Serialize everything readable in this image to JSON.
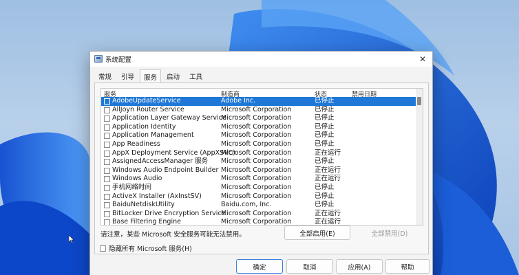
{
  "window": {
    "title": "系统配置",
    "close_glyph": "✕"
  },
  "tabs": [
    {
      "label": "常规",
      "active": false
    },
    {
      "label": "引导",
      "active": false
    },
    {
      "label": "服务",
      "active": true
    },
    {
      "label": "启动",
      "active": false
    },
    {
      "label": "工具",
      "active": false
    }
  ],
  "services": {
    "columns": {
      "service": "服务",
      "manufacturer": "制造商",
      "status": "状态",
      "disabled_date": "禁用日期"
    },
    "rows": [
      {
        "name": "AdobeUpdateService",
        "manufacturer": "Adobe Inc.",
        "status": "已停止",
        "selected": true
      },
      {
        "name": "AllJoyn Router Service",
        "manufacturer": "Microsoft Corporation",
        "status": "已停止"
      },
      {
        "name": "Application Layer Gateway Service",
        "manufacturer": "Microsoft Corporation",
        "status": "已停止"
      },
      {
        "name": "Application Identity",
        "manufacturer": "Microsoft Corporation",
        "status": "已停止"
      },
      {
        "name": "Application Management",
        "manufacturer": "Microsoft Corporation",
        "status": "已停止"
      },
      {
        "name": "App Readiness",
        "manufacturer": "Microsoft Corporation",
        "status": "已停止"
      },
      {
        "name": "AppX Deployment Service (AppXSVC)",
        "manufacturer": "Microsoft Corporation",
        "status": "正在运行"
      },
      {
        "name": "AssignedAccessManager 服务",
        "manufacturer": "Microsoft Corporation",
        "status": "已停止"
      },
      {
        "name": "Windows Audio Endpoint Builder",
        "manufacturer": "Microsoft Corporation",
        "status": "正在运行"
      },
      {
        "name": "Windows Audio",
        "manufacturer": "Microsoft Corporation",
        "status": "正在运行"
      },
      {
        "name": "手机网络时间",
        "manufacturer": "Microsoft Corporation",
        "status": "已停止"
      },
      {
        "name": "ActiveX Installer (AxInstSV)",
        "manufacturer": "Microsoft Corporation",
        "status": "已停止"
      },
      {
        "name": "BaiduNetdiskUtility",
        "manufacturer": "Baidu.com, Inc.",
        "status": "已停止"
      },
      {
        "name": "BitLocker Drive Encryption Service",
        "manufacturer": "Microsoft Corporation",
        "status": "正在运行"
      },
      {
        "name": "Base Filtering Engine",
        "manufacturer": "Microsoft Corporation",
        "status": "正在运行"
      }
    ]
  },
  "note": "请注意，某些 Microsoft 安全服务可能无法禁用。",
  "buttons": {
    "enable_all": "全部启用(E)",
    "disable_all": "全部禁用(D)",
    "ok": "确定",
    "cancel": "取消",
    "apply": "应用(A)",
    "help": "帮助"
  },
  "hide_ms_label": "隐藏所有 Microsoft 服务(H)",
  "colors": {
    "selection": "#1f78d7",
    "wallpaper_blue": "#1f5fd6"
  }
}
